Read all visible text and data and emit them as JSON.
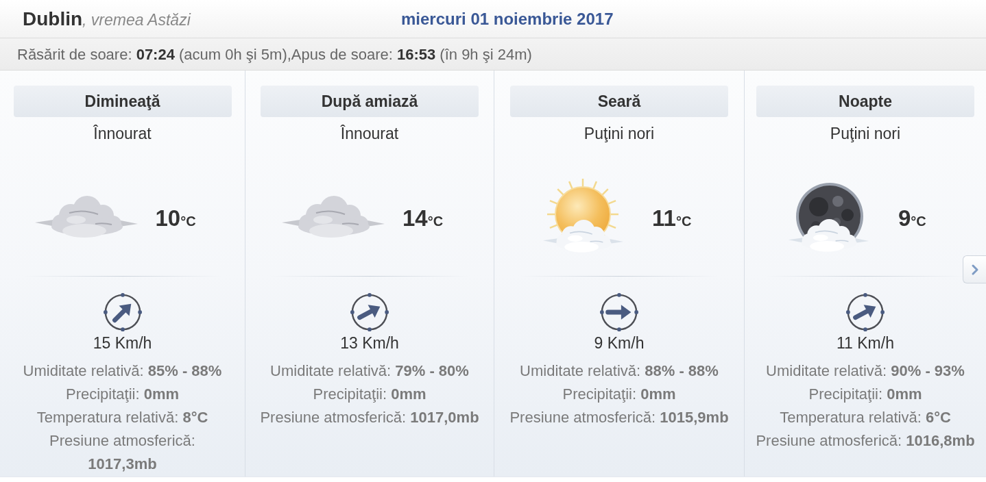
{
  "header": {
    "city": "Dublin",
    "subtitle": ", vremea Astăzi",
    "date": "miercuri 01 noiembrie 2017"
  },
  "sun_info": "Răsărit de soare: **07:24** (acum 0h şi 5m),Apus de soare: **16:53** (în 9h şi 24m)",
  "periods": [
    {
      "name": "Dimineaţă",
      "condition": "Înnourat",
      "kind": "overcast",
      "temperature": "10",
      "unit": "°C",
      "wind": {
        "kind": "ne",
        "speed": "15 Km/h"
      },
      "details": [
        "Umiditate relativă: **85% - 88%**",
        "Precipitaţii: **0mm**",
        "Temperatura relativă: **8°C**",
        "Presiune atmosferică: **1017,3mb**"
      ]
    },
    {
      "name": "După amiază",
      "condition": "Înnourat",
      "kind": "overcast",
      "temperature": "14",
      "unit": "°C",
      "wind": {
        "kind": "ene",
        "speed": "13 Km/h"
      },
      "details": [
        "Umiditate relativă: **79% - 80%**",
        "Precipitaţii: **0mm**",
        "Presiune atmosferică: **1017,0mb**"
      ]
    },
    {
      "name": "Seară",
      "condition": "Puţini nori",
      "kind": "sun",
      "temperature": "11",
      "unit": "°C",
      "wind": {
        "kind": "e",
        "speed": "9 Km/h"
      },
      "details": [
        "Umiditate relativă: **88% - 88%**",
        "Precipitaţii: **0mm**",
        "Presiune atmosferică: **1015,9mb**"
      ]
    },
    {
      "name": "Noapte",
      "condition": "Puţini nori",
      "kind": "moon",
      "temperature": "9",
      "unit": "°C",
      "wind": {
        "kind": "ene",
        "speed": "11 Km/h"
      },
      "details": [
        "Umiditate relativă: **90% - 93%**",
        "Precipitaţii: **0mm**",
        "Temperatura relativă: **6°C**",
        "Presiune atmosferică: **1016,8mb**"
      ]
    }
  ]
}
